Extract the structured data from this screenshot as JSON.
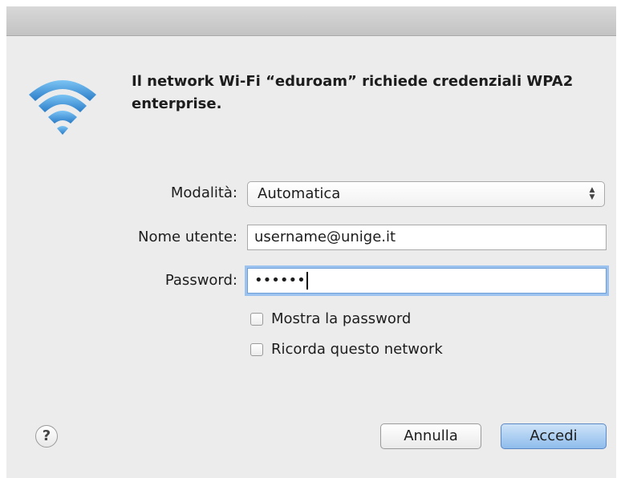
{
  "dialog": {
    "message": "Il network Wi-Fi “eduroam” richiede credenziali WPA2 enterprise."
  },
  "form": {
    "mode_label": "Modalità:",
    "mode_value": "Automatica",
    "username_label": "Nome utente:",
    "username_value": "username@unige.it",
    "password_label": "Password:",
    "password_masked": "••••••"
  },
  "options": {
    "show_password_label": "Mostra la password",
    "show_password_checked": false,
    "remember_label": "Ricorda questo network",
    "remember_checked": false
  },
  "buttons": {
    "help_label": "?",
    "cancel_label": "Annulla",
    "confirm_label": "Accedi"
  },
  "icons": {
    "wifi": "wifi-icon",
    "select_arrows": "up-down-arrows-icon"
  },
  "colors": {
    "wifi_blue": "#3a8fd8",
    "focus_ring": "#9cc2ef",
    "default_button": "#8fbcec"
  }
}
